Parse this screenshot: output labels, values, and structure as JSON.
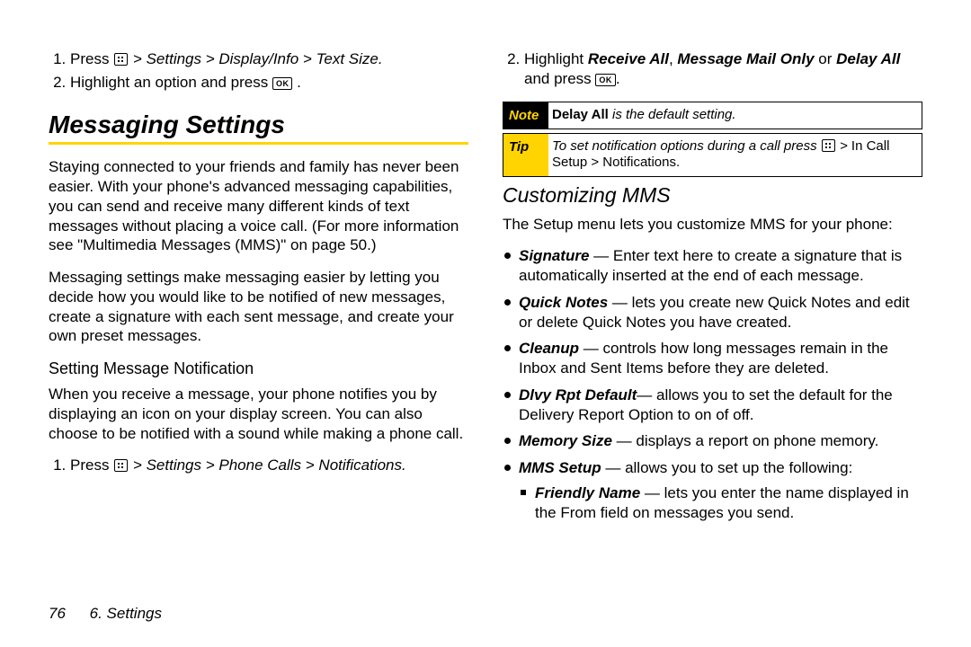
{
  "left": {
    "step1_pre": "Press ",
    "step1_path": "> Settings > Display/Info > Text Size.",
    "step2_pre": "Highlight an option and press ",
    "step2_post": ".",
    "section_title": "Messaging Settings",
    "para1": "Staying connected to your friends and family has never been easier. With your phone's advanced messaging capabilities, you can send and receive many different kinds of text messages without placing a voice call. (For more information see \"Multimedia Messages (MMS)\" on page 50.)",
    "para2": "Messaging settings make messaging easier by letting you decide how you would like to be notified of new messages, create a signature with each sent message, and create your own preset messages.",
    "sub_title": "Setting Message Notification",
    "para3": "When you receive a message, your phone notifies you by displaying an icon on your display screen. You can also choose to be notified with a sound while making a phone call.",
    "step3_pre": "Press ",
    "step3_path": "> Settings > Phone Calls > Notifications."
  },
  "right": {
    "step2_pre": "Highlight ",
    "step2_opt1": "Receive All",
    "step2_sep1": ", ",
    "step2_opt2": "Message Mail Only",
    "step2_sep2": " or ",
    "step2_opt3": "Delay All",
    "step2_mid": " and press ",
    "step2_post": ".",
    "note_label": "Note",
    "note_bold": "Delay All",
    "note_rest": " is the default setting.",
    "tip_label": "Tip",
    "tip_text1": "To set notification options during a call press ",
    "tip_gt": " > ",
    "tip_path": "In Call Setup > Notifications.",
    "sub_title": "Customizing MMS",
    "para1": "The Setup menu lets you customize MMS for your phone:",
    "items": [
      {
        "name": "Signature",
        "dash": " — ",
        "desc": "Enter text here to create a signature that is automatically inserted at the end of each message."
      },
      {
        "name": "Quick Notes",
        "dash": " — ",
        "desc": "lets you create new Quick Notes and edit or delete Quick Notes you have created."
      },
      {
        "name": "Cleanup",
        "dash": " — ",
        "desc": "controls how long messages remain in the Inbox and Sent Items before they are deleted."
      },
      {
        "name": "Dlvy Rpt Default",
        "dash": "— ",
        "desc": "allows you to set the default for the Delivery Report Option to on of off."
      },
      {
        "name": "Memory Size",
        "dash": " — ",
        "desc": "displays a report on phone memory."
      },
      {
        "name": "MMS Setup",
        "dash": " — ",
        "desc": "allows you to set up the following:",
        "child": {
          "name": "Friendly Name",
          "dash": " — ",
          "desc": "lets you enter the name displayed in the From field on messages you send."
        }
      }
    ]
  },
  "footer": {
    "page_number": "76",
    "chapter": "6. Settings"
  },
  "ok_label": "OK"
}
